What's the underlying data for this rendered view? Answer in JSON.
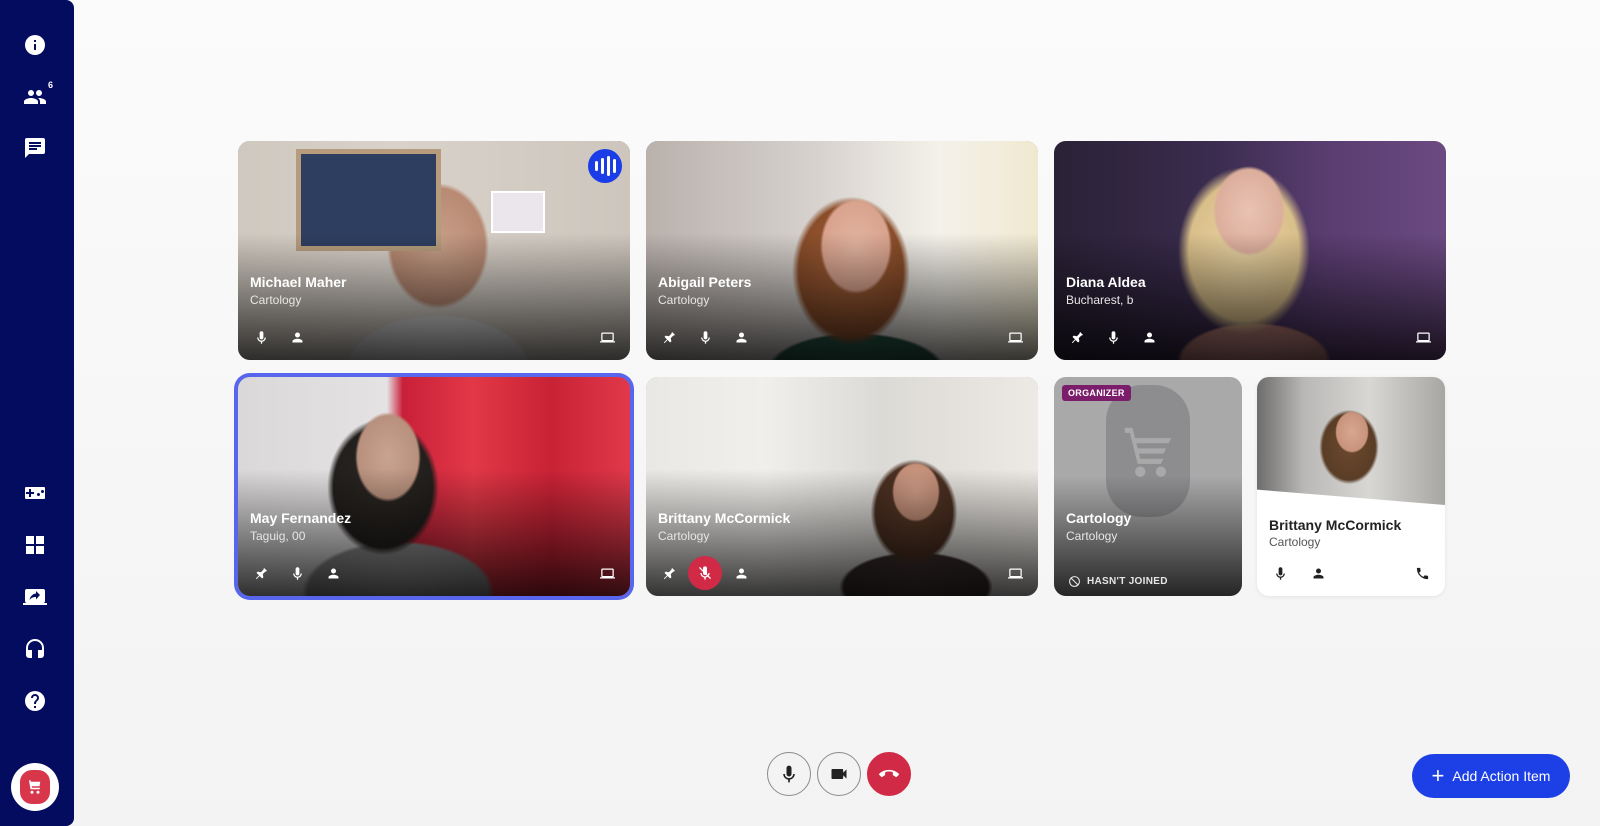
{
  "sidebar": {
    "participant_count": "6"
  },
  "participants": [
    {
      "name": "Michael Maher",
      "subtitle": "Cartology"
    },
    {
      "name": "Abigail Peters",
      "subtitle": "Cartology"
    },
    {
      "name": "Diana Aldea",
      "subtitle": "Bucharest, b"
    },
    {
      "name": "May Fernandez",
      "subtitle": "Taguig, 00"
    },
    {
      "name": "Brittany McCormick",
      "subtitle": "Cartology"
    },
    {
      "name": "Cartology",
      "subtitle": "Cartology",
      "badge": "ORGANIZER",
      "status": "HASN'T JOINED"
    },
    {
      "name": "Brittany McCormick",
      "subtitle": "Cartology"
    }
  ],
  "actions": {
    "add_action_item": "Add Action Item"
  },
  "colors": {
    "sidebar": "#030c5f",
    "accent": "#1d3fe6",
    "danger": "#d02a46",
    "selection": "#5866ee",
    "organizer_badge": "#7b1d6b"
  }
}
